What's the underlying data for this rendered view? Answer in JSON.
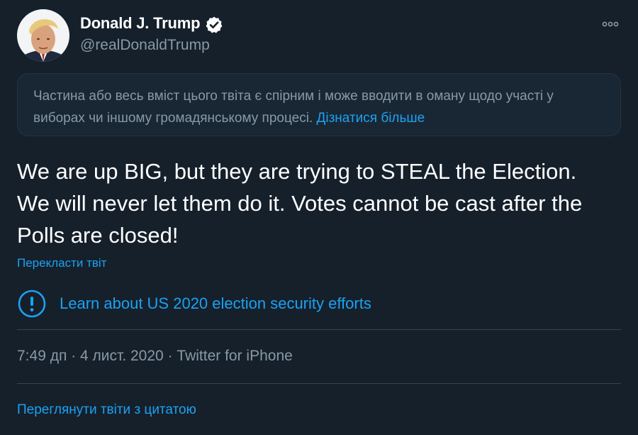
{
  "author": {
    "display_name": "Donald J. Trump",
    "handle": "@realDonaldTrump",
    "verified": true,
    "avatar_icon": "user-avatar"
  },
  "more_icon": "more-horizontal-icon",
  "notice": {
    "text": "Частина або весь вміст цього твіта є спірним і може вводити в оману щодо участі у виборах чи іншому громадянському процесі.",
    "link_label": "Дізнатися більше"
  },
  "tweet": {
    "text": "We are up BIG, but they are trying to STEAL the Election. We will never let them do it. Votes cannot be cast after the Polls are closed!",
    "translate_label": "Перекласти твіт"
  },
  "election_notice": {
    "icon": "alert-circle-icon",
    "label": "Learn about US 2020 election security efforts"
  },
  "meta": {
    "time": "7:49 дп",
    "date": "4 лист. 2020",
    "separator": "·",
    "source": "Twitter for iPhone"
  },
  "quotes_link": "Переглянути твіти з цитатою",
  "colors": {
    "background": "#15202b",
    "accent": "#1da1f2",
    "secondary_text": "#8899a6",
    "border": "#38444d"
  }
}
